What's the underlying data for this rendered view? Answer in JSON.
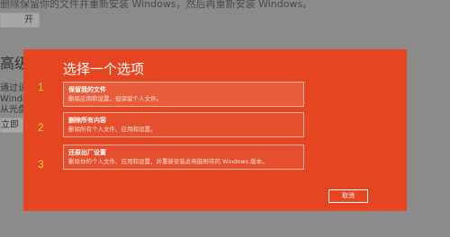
{
  "background": {
    "top_text": "删除保留你的文件并重新安装 Windows，然后再重新安装 Windows。",
    "button1_label": "开始",
    "heading": "高级启动",
    "desc_lines": [
      "通过设备或磁盘",
      "Windows 启动设置",
      "从光盘或电脑。"
    ],
    "button2_label": "立即重启"
  },
  "dialog": {
    "title": "选择一个选项",
    "options": [
      {
        "number": "1",
        "title": "保留我的文件",
        "desc": "删除应用和设置，但保留个人文件。"
      },
      {
        "number": "2",
        "title": "删除所有内容",
        "desc": "删除所有个人文件、应用和设置。"
      },
      {
        "number": "3",
        "title": "还原出厂设置",
        "desc": "删除你的个人文件、应用和设置，并重新安装此电脑附带的 Windows 版本。"
      }
    ],
    "cancel_label": "取消"
  },
  "colors": {
    "dialog_bg": "#e54520",
    "number_color": "#f5d23c",
    "page_bg": "#8b8b8b"
  }
}
